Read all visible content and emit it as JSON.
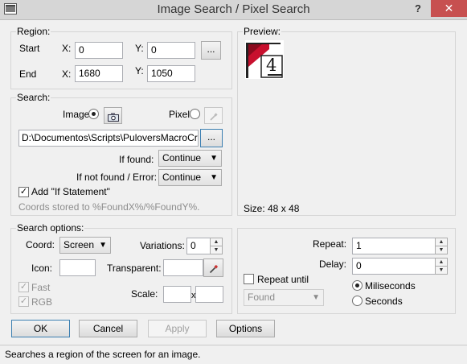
{
  "window": {
    "title": "Image Search / Pixel Search",
    "help": "?",
    "close": "✕"
  },
  "region": {
    "label": "Region:",
    "start_label": "Start",
    "end_label": "End",
    "x_label": "X:",
    "y_label": "Y:",
    "start_x": "0",
    "start_y": "0",
    "end_x": "1680",
    "end_y": "1050",
    "browse": "..."
  },
  "search": {
    "label": "Search:",
    "image_label": "Image",
    "pixel_label": "Pixel",
    "path": "D:\\Documentos\\Scripts\\PuloversMacroCreato",
    "browse": "...",
    "if_found_label": "If found:",
    "if_found_value": "Continue",
    "not_found_label": "If not found / Error:",
    "not_found_value": "Continue",
    "add_if_label": "Add \"If Statement\"",
    "coords_note": "Coords stored to %FoundX%/%FoundY%."
  },
  "preview": {
    "label": "Preview:",
    "size_text": "Size: 48 x 48",
    "glyph": "4"
  },
  "options": {
    "label": "Search options:",
    "coord_label": "Coord:",
    "coord_value": "Screen",
    "variations_label": "Variations:",
    "variations_value": "0",
    "icon_label": "Icon:",
    "transparent_label": "Transparent:",
    "fast_label": "Fast",
    "rgb_label": "RGB",
    "scale_label": "Scale:",
    "scale_x": "x"
  },
  "repeat": {
    "repeat_label": "Repeat:",
    "repeat_value": "1",
    "delay_label": "Delay:",
    "delay_value": "0",
    "repeat_until_label": "Repeat until",
    "until_value": "Found",
    "ms_label": "Miliseconds",
    "sec_label": "Seconds"
  },
  "buttons": {
    "ok": "OK",
    "cancel": "Cancel",
    "apply": "Apply",
    "options": "Options"
  },
  "status": {
    "text": "Searches a region of the screen for an image."
  },
  "colors": {
    "close_bg": "#c75050",
    "preview_red": "#c8102e"
  }
}
